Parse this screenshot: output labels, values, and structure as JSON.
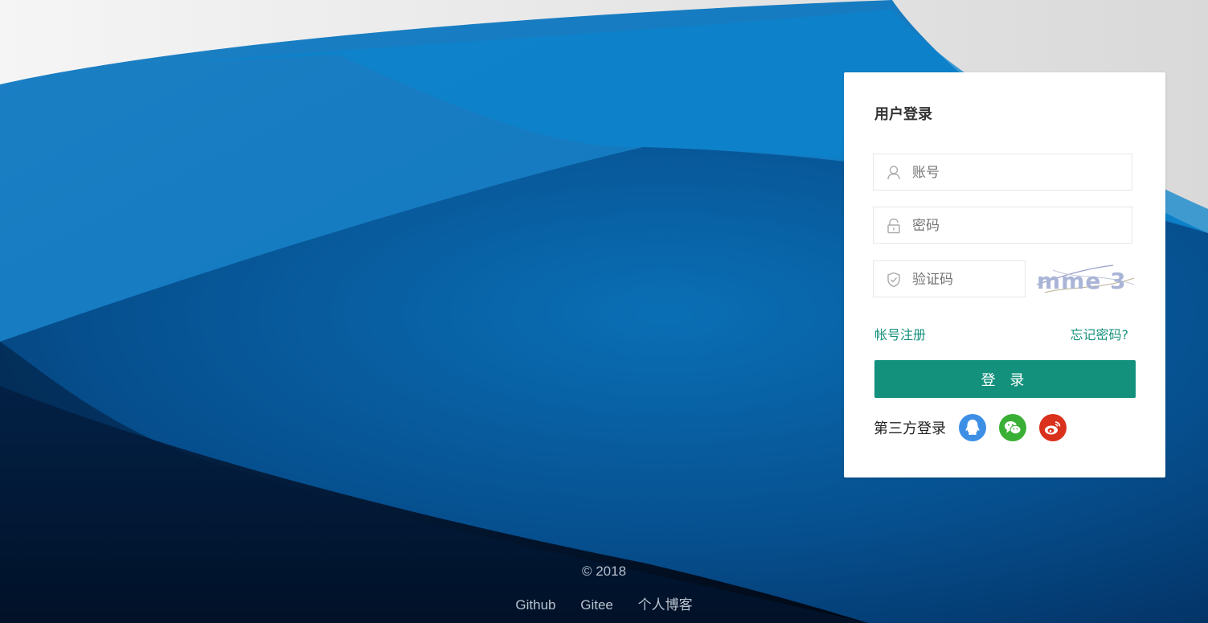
{
  "login": {
    "title": "用户登录",
    "username_placeholder": "账号",
    "password_placeholder": "密码",
    "captcha_placeholder": "验证码",
    "captcha_text": "mme 3",
    "register_link": "帐号注册",
    "forgot_link": "忘记密码?",
    "login_button": "登 录",
    "third_party_label": "第三方登录",
    "third_party_icons": [
      "qq-icon",
      "wechat-icon",
      "weibo-icon"
    ]
  },
  "footer": {
    "copyright": "© 2018",
    "links": [
      "Github",
      "Gitee",
      "个人博客"
    ]
  },
  "colors": {
    "accent": "#13917d",
    "qq": "#3d8fe6",
    "wechat": "#3aaf35",
    "weibo": "#d9311b"
  }
}
